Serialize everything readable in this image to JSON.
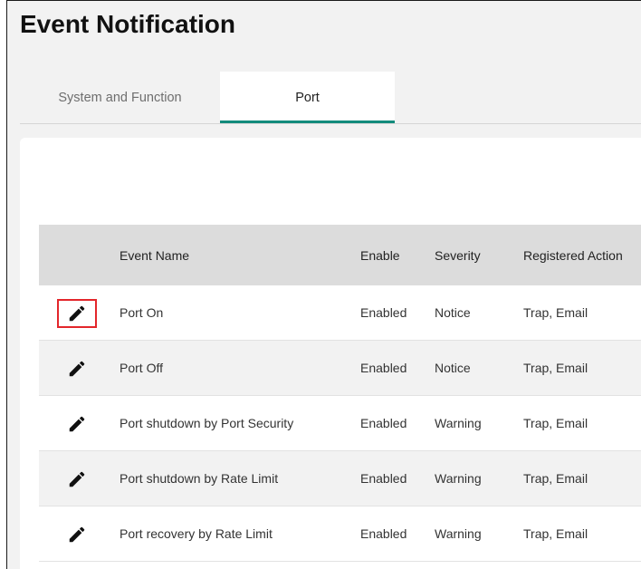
{
  "page": {
    "title": "Event Notification"
  },
  "tabs": [
    {
      "label": "System and Function",
      "active": false
    },
    {
      "label": "Port",
      "active": true
    }
  ],
  "colors": {
    "accent": "#138b7c",
    "highlight": "#e3262b",
    "header_bg": "#dcdcdc"
  },
  "table": {
    "columns": {
      "name": "Event Name",
      "enable": "Enable",
      "severity": "Severity",
      "actions": "Registered Action"
    },
    "rows": [
      {
        "name": "Port On",
        "enable": "Enabled",
        "severity": "Notice",
        "actions": "Trap, Email",
        "edit_icon": "pencil-icon",
        "highlighted": true
      },
      {
        "name": "Port Off",
        "enable": "Enabled",
        "severity": "Notice",
        "actions": "Trap, Email",
        "edit_icon": "pencil-icon",
        "highlighted": false
      },
      {
        "name": "Port shutdown by Port Security",
        "enable": "Enabled",
        "severity": "Warning",
        "actions": "Trap, Email",
        "edit_icon": "pencil-icon",
        "highlighted": false
      },
      {
        "name": "Port shutdown by Rate Limit",
        "enable": "Enabled",
        "severity": "Warning",
        "actions": "Trap, Email",
        "edit_icon": "pencil-icon",
        "highlighted": false
      },
      {
        "name": "Port recovery by Rate Limit",
        "enable": "Enabled",
        "severity": "Warning",
        "actions": "Trap, Email",
        "edit_icon": "pencil-icon",
        "highlighted": false
      }
    ]
  }
}
